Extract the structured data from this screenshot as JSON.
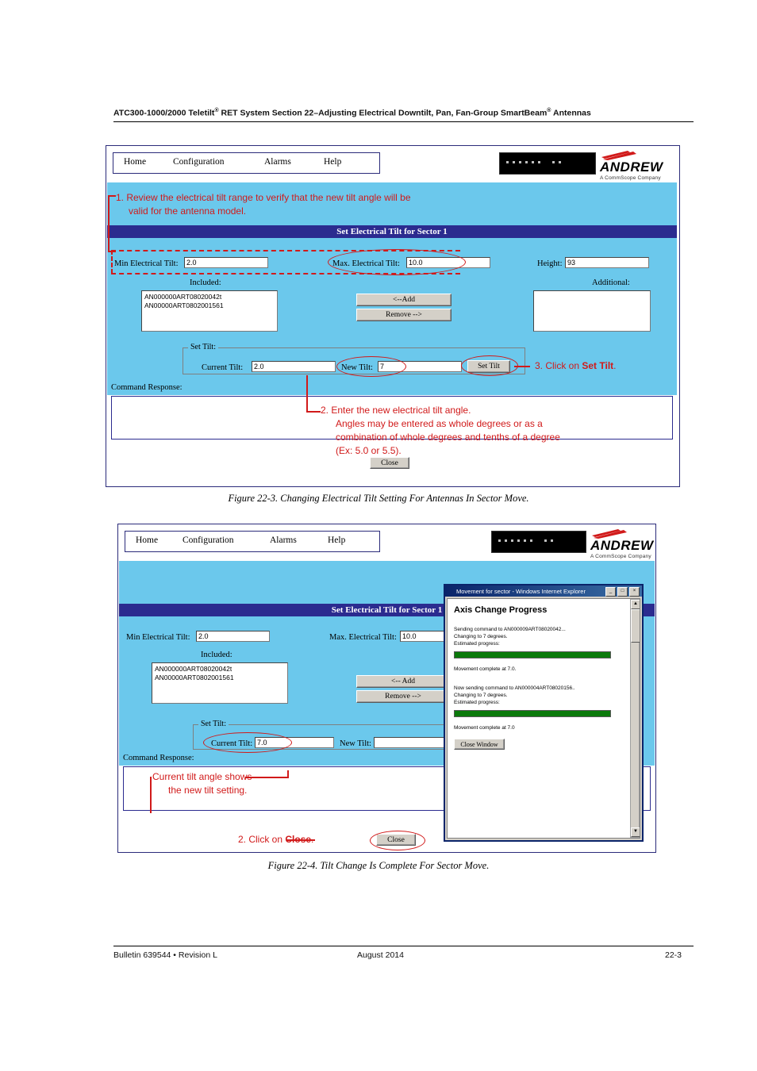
{
  "header": {
    "line": "ATC300-1000/2000 Teletilt® RET System  Section 22–Adjusting Electrical Downtilt, Pan, Fan-Group SmartBeam® Antennas",
    "part1": "ATC300-1000/2000 Teletilt",
    "reg1": "®",
    "part2": " RET System  Section 22–Adjusting Electrical Downtilt, Pan, Fan-Group SmartBeam",
    "reg2": "®",
    "part3": " Antennas"
  },
  "nav": {
    "home": "Home",
    "configuration": "Configuration",
    "alarms": "Alarms",
    "help": "Help"
  },
  "brand": {
    "name": "ANDREW",
    "tagline": "A CommScope Company"
  },
  "figure1": {
    "title": "Set Electrical Tilt for Sector 1",
    "min_label": "Min Electrical Tilt:",
    "min_value": "2.0",
    "max_label": "Max. Electrical Tilt:",
    "max_value": "10.0",
    "height_label": "Height:",
    "height_value": "93",
    "included_label": "Included:",
    "included_items": [
      "AN000000ART08020042t",
      "AN00000ART0802001561"
    ],
    "additional_label": "Additional:",
    "additional_items": [],
    "add_button": "<--Add",
    "remove_button": "Remove -->",
    "set_tilt_group": "Set Tilt:",
    "current_tilt_label": "Current Tilt:",
    "current_tilt_value": "2.0",
    "new_tilt_label": "New Tilt:",
    "new_tilt_value": "7",
    "set_tilt_button": "Set Tilt",
    "command_response_label": "Command Response:",
    "command_response_value": "",
    "close_button": "Close",
    "annotations": {
      "step1": "1. Review the electrical tilt range to verify that the new tilt angle will be valid for the antenna model.",
      "step1_line1": "1. Review the electrical tilt range to verify that the new tilt angle will be",
      "step1_line2": "valid for the antenna model.",
      "step2_line1": "2.  Enter the new electrical tilt angle.",
      "step2_line2": "Angles may be entered as whole degrees or as a",
      "step2_line3": "combination of whole degrees and tenths of a degree",
      "step2_line4": "(Ex: 5.0 or 5.5).",
      "step3_pre": "3. Click on ",
      "step3_bold": "Set Tilt",
      "step3_post": "."
    },
    "caption": "Figure 22-3.  Changing Electrical Tilt Setting For Antennas In Sector Move."
  },
  "figure2": {
    "title": "Set Electrical Tilt for Sector 1",
    "min_label": "Min Electrical Tilt:",
    "min_value": "2.0",
    "max_label": "Max. Electrical Tilt:",
    "max_value": "10.0",
    "included_label": "Included:",
    "included_items": [
      "AN000000ART08020042t",
      "AN00000ART0802001561"
    ],
    "add_button": "<-- Add",
    "remove_button": "Remove -->",
    "set_tilt_group": "Set Tilt:",
    "current_tilt_label": "Current Tilt:",
    "current_tilt_value": "7.0",
    "new_tilt_label": "New Tilt:",
    "new_tilt_value": "",
    "command_response_label": "Command Response:",
    "close_button": "Close",
    "annotations": {
      "note_line1": "Current tilt angle shows",
      "note_line2": "the new tilt setting.",
      "step2_pre": "2.  Click on ",
      "step2_bold": "Close",
      "step2_post": "."
    },
    "popup": {
      "titlebar": "Movement for sector - Windows Internet Explorer",
      "min_btn": "_",
      "max_btn": "□",
      "close_btn": "×",
      "heading": "Axis Change Progress",
      "body1": "Sending command to AN000009ART08020042...\nChanging to 7 degrees.\nEstimated progress:",
      "body2": "Movement complete at 7.0.",
      "body3": "Now sending command to AN000004ART08020156..\nChanging to 7 degrees.\nEstimated progress:",
      "body4": "Movement complete at 7.0",
      "close_window_button": "Close Window",
      "scroll_up": "▲",
      "scroll_down": "▼"
    },
    "caption": "Figure 22-4.  Tilt Change Is Complete For Sector Move."
  },
  "footer": {
    "left": "Bulletin 639544  •  Revision L",
    "center": "August 2014",
    "right": "22-3"
  }
}
